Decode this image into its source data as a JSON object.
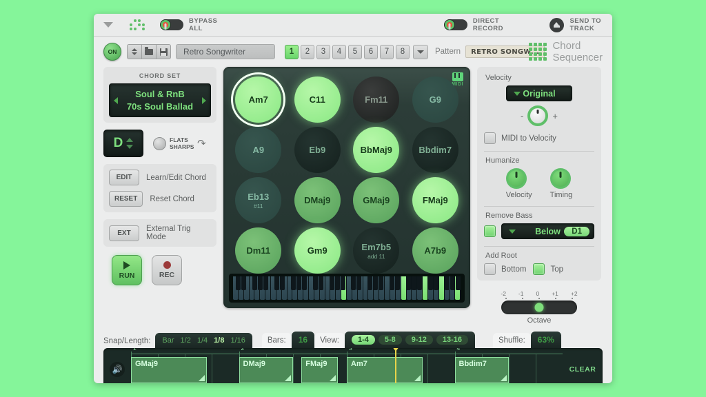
{
  "host_bar": {
    "bypass_label_line1": "BYPASS",
    "bypass_label_line2": "ALL",
    "direct_label_line1": "DIRECT",
    "direct_label_line2": "RECORD",
    "send_label_line1": "SEND TO",
    "send_label_line2": "TRACK"
  },
  "header": {
    "power_label": "ON",
    "preset_name": "Retro Songwriter",
    "pattern_numbers": [
      "1",
      "2",
      "3",
      "4",
      "5",
      "6",
      "7",
      "8"
    ],
    "active_pattern": "1",
    "pattern_label": "Pattern",
    "pattern_value": "RETRO SONGW...",
    "brand_line1": "Chord",
    "brand_line2": "Sequencer"
  },
  "left": {
    "chord_set_caption": "CHORD SET",
    "chord_set_category": "Soul & RnB",
    "chord_set_name": "70s Soul Ballad",
    "key_value": "D",
    "flats_label": "FLATS",
    "sharps_label": "SHARPS",
    "edit_button": "EDIT",
    "edit_text": "Learn/Edit Chord",
    "reset_button": "RESET",
    "reset_text": "Reset Chord",
    "ext_button": "EXT",
    "ext_text": "External Trig Mode",
    "run_label": "RUN",
    "rec_label": "REC"
  },
  "grid": {
    "midi_label": "MIDI",
    "pads": [
      {
        "name": "Am7",
        "sub": "",
        "tier": "t5",
        "selected": true
      },
      {
        "name": "C11",
        "sub": "",
        "tier": "t5",
        "selected": false
      },
      {
        "name": "Fm11",
        "sub": "",
        "tier": "dk2",
        "selected": false
      },
      {
        "name": "G9",
        "sub": "",
        "tier": "t1",
        "selected": false
      },
      {
        "name": "A9",
        "sub": "",
        "tier": "t1",
        "selected": false
      },
      {
        "name": "Eb9",
        "sub": "",
        "tier": "dk",
        "selected": false
      },
      {
        "name": "BbMaj9",
        "sub": "",
        "tier": "t5",
        "selected": false
      },
      {
        "name": "Bbdim7",
        "sub": "",
        "tier": "dk",
        "selected": false
      },
      {
        "name": "Eb13",
        "sub": "#11",
        "tier": "t1",
        "selected": false
      },
      {
        "name": "DMaj9",
        "sub": "",
        "tier": "t3",
        "selected": false
      },
      {
        "name": "GMaj9",
        "sub": "",
        "tier": "t3",
        "selected": false
      },
      {
        "name": "FMaj9",
        "sub": "",
        "tier": "t5",
        "selected": false
      },
      {
        "name": "Dm11",
        "sub": "",
        "tier": "t3",
        "selected": false
      },
      {
        "name": "Gm9",
        "sub": "",
        "tier": "t5",
        "selected": false
      },
      {
        "name": "Em7b5",
        "sub": "add 11",
        "tier": "dk",
        "selected": false
      },
      {
        "name": "A7b9",
        "sub": "",
        "tier": "t3",
        "selected": false
      }
    ],
    "lit_keys": [
      20,
      31,
      35,
      38,
      41
    ]
  },
  "right": {
    "velocity_label": "Velocity",
    "velocity_mode": "Original",
    "minus": "-",
    "plus": "+",
    "midi_to_velocity": "MIDI to Velocity",
    "humanize_label": "Humanize",
    "humanize_velocity": "Velocity",
    "humanize_timing": "Timing",
    "remove_bass_label": "Remove Bass",
    "remove_bass_mode": "Below",
    "remove_bass_note": "D1",
    "add_root_label": "Add Root",
    "add_root_bottom": "Bottom",
    "add_root_top": "Top",
    "octave_ticks": [
      "-2",
      "-1",
      "0",
      "+1",
      "+2"
    ],
    "octave_label": "Octave"
  },
  "bottom": {
    "snap_label": "Snap/Length:",
    "snap_options": [
      "Bar",
      "1/2",
      "1/4",
      "1/8",
      "1/16"
    ],
    "snap_active": "1/8",
    "bars_label": "Bars:",
    "bars_value": "16",
    "view_label": "View:",
    "view_options": [
      "1-4",
      "5-8",
      "9-12",
      "13-16"
    ],
    "view_active": "1-4",
    "shuffle_label": "Shuffle:",
    "shuffle_value": "63%",
    "clear_label": "CLEAR",
    "bar_numbers": [
      "1",
      "2",
      "3",
      "4"
    ],
    "clips": [
      {
        "name": "GMaj9",
        "start": 0.0,
        "length": 0.175
      },
      {
        "name": "DMaj9",
        "start": 0.25,
        "length": 0.125
      },
      {
        "name": "FMaj9",
        "start": 0.395,
        "length": 0.085
      },
      {
        "name": "Am7",
        "start": 0.5,
        "length": 0.175
      },
      {
        "name": "Bbdim7",
        "start": 0.75,
        "length": 0.125
      }
    ],
    "playhead_position": 0.612
  }
}
